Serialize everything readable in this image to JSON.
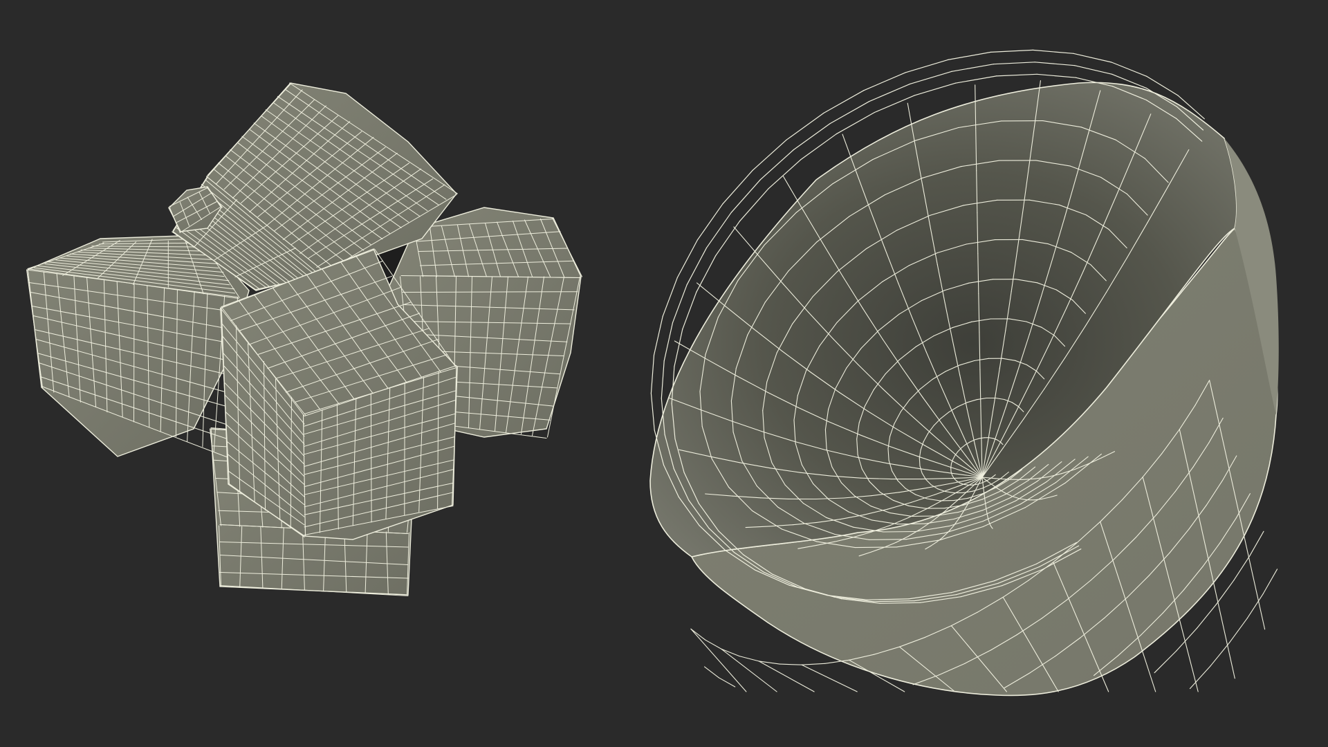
{
  "colors": {
    "background": "#2a2a2a",
    "mesh_fill": "#7b7c6e",
    "mesh_fill_light": "#8a8b7d",
    "mesh_fill_dark": "#55564c",
    "interior_shadow": "#3f403a",
    "wire": "#eeeedd",
    "gap_shadow": "#1e1e1e"
  },
  "objects": [
    {
      "name": "sugar-cubes-cluster",
      "kind": "wireframe-mesh"
    },
    {
      "name": "sugar-bowl",
      "kind": "wireframe-mesh"
    }
  ]
}
